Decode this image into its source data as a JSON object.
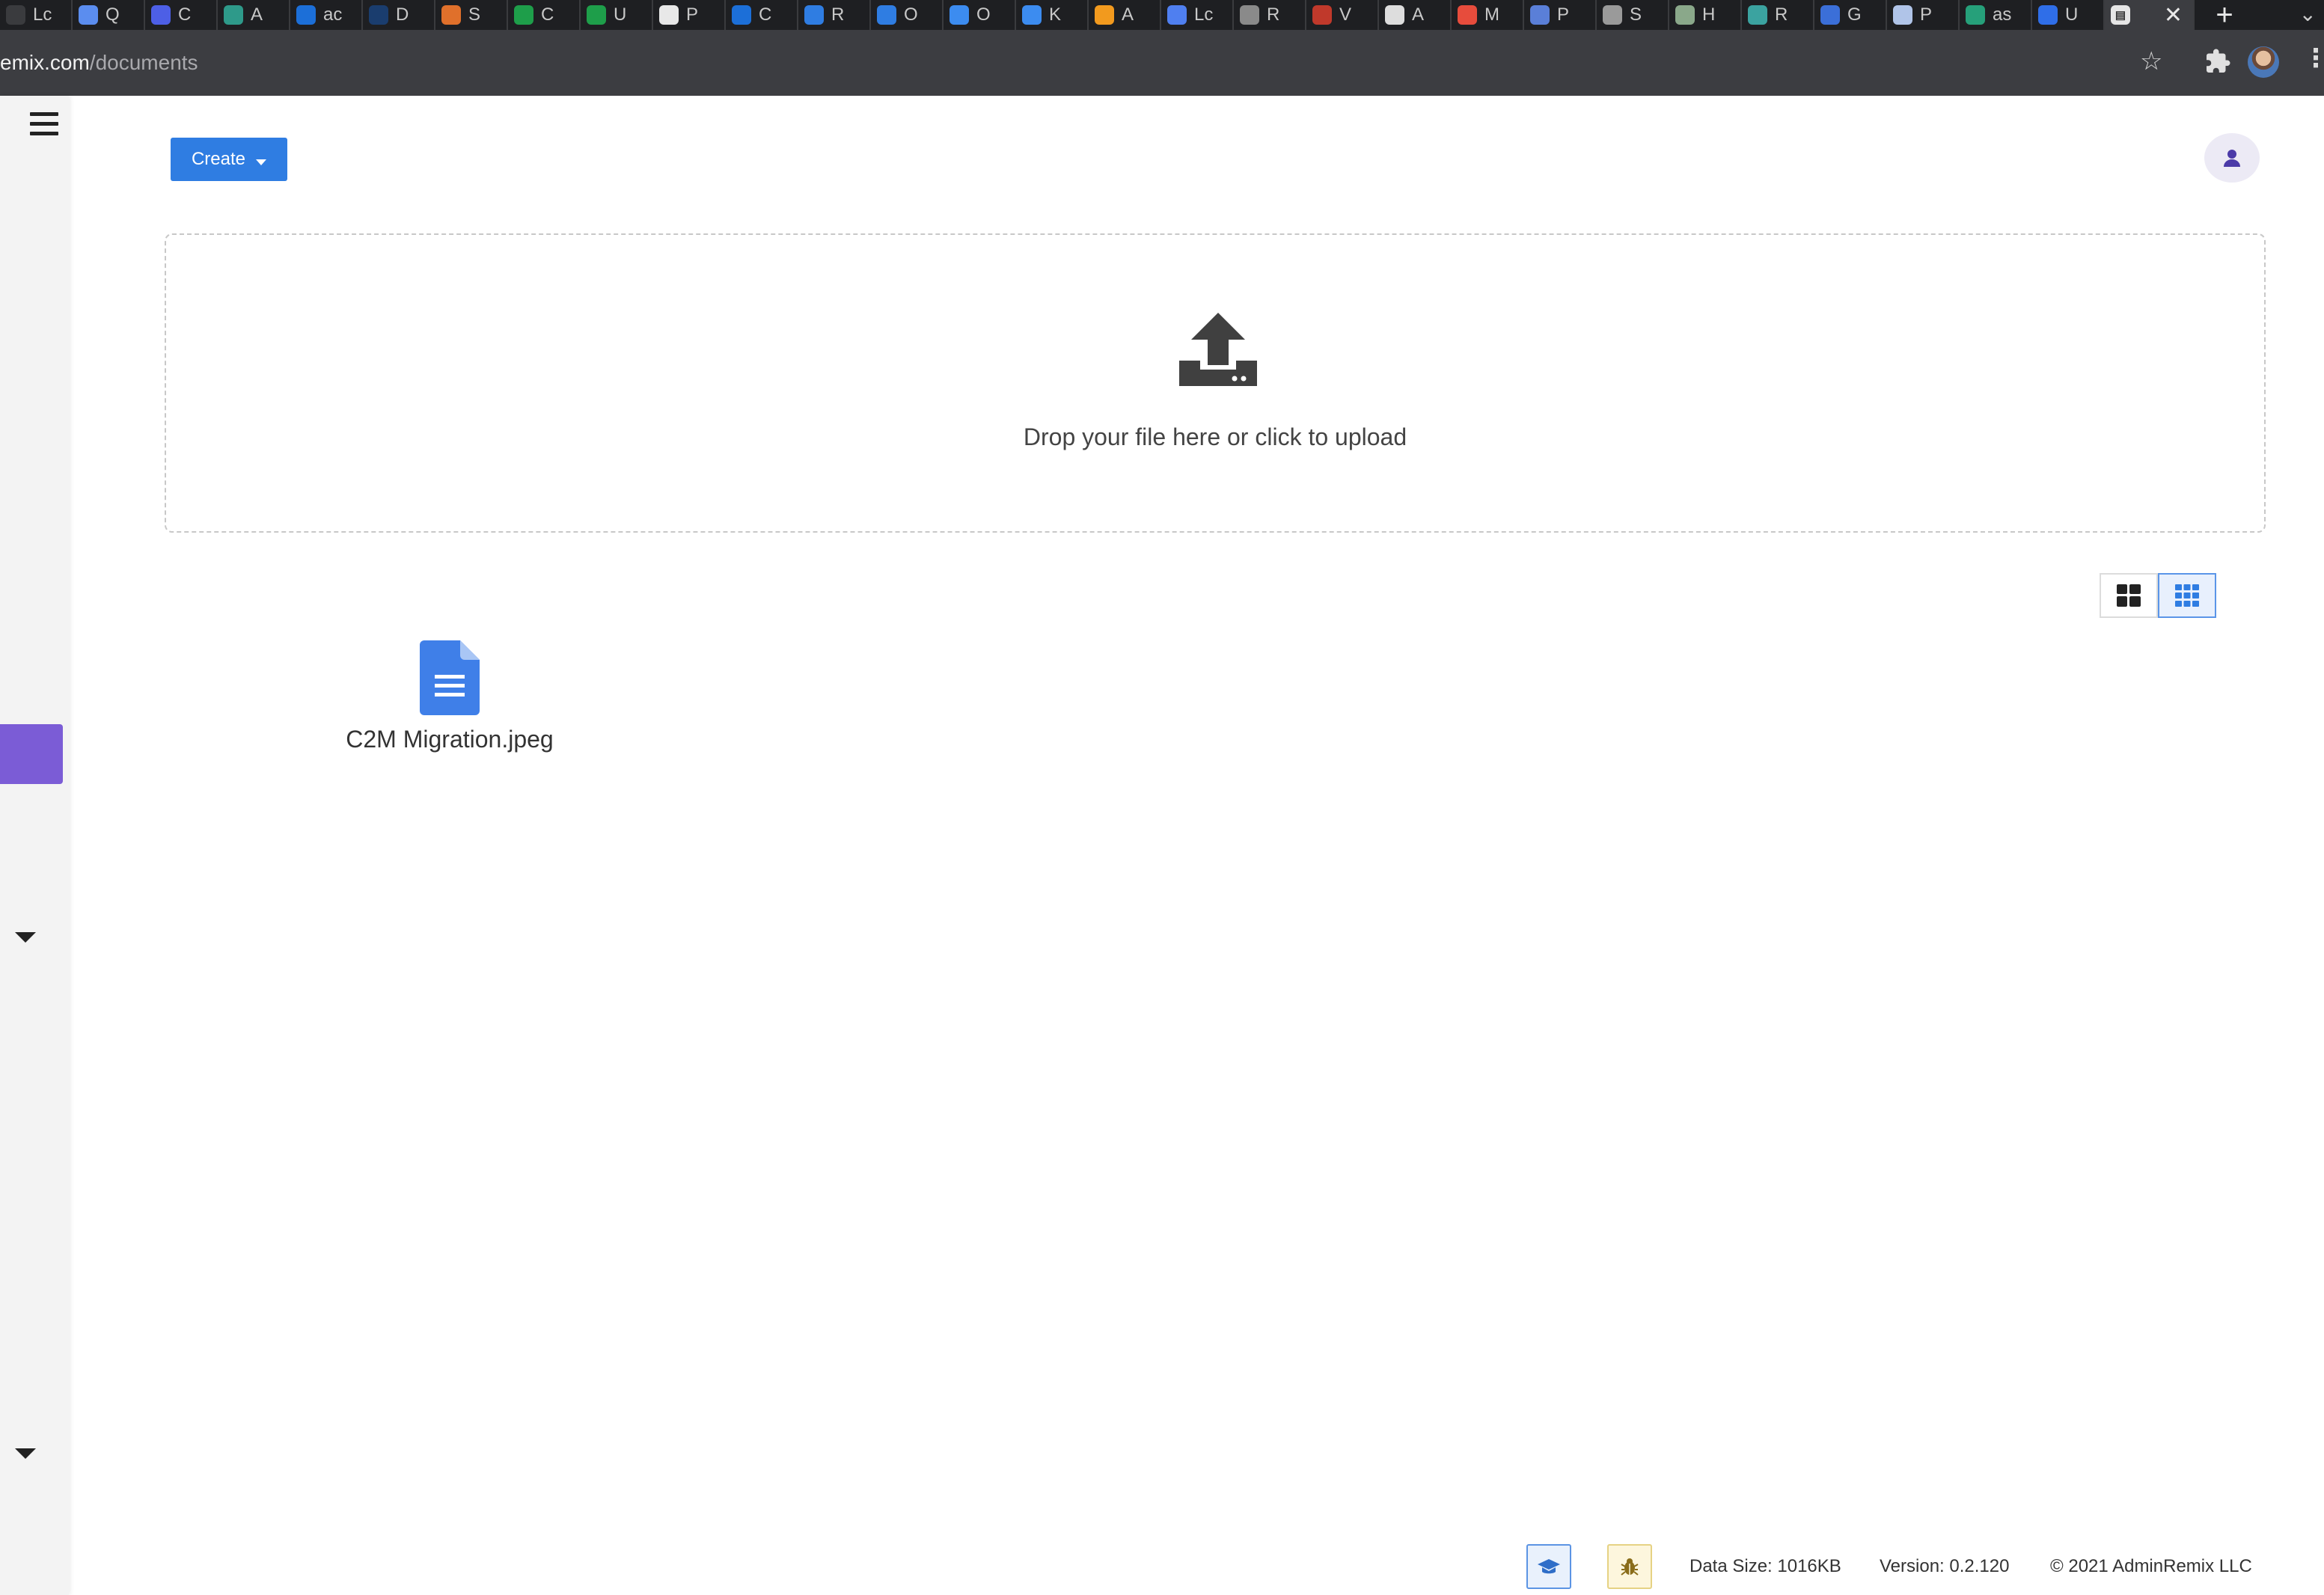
{
  "browser": {
    "tabs": [
      {
        "title": "Lc",
        "icon": "generic-tab-icon",
        "color": "#3a3b3e"
      },
      {
        "title": "Q",
        "icon": "q-tab-icon",
        "color": "#5b8def"
      },
      {
        "title": "C",
        "icon": "c-tab-icon",
        "color": "#4d5fe6"
      },
      {
        "title": "A",
        "icon": "gear-tab-icon",
        "color": "#2e9a8a"
      },
      {
        "title": "ac",
        "icon": "leaf-tab-icon",
        "color": "#1c6fd8"
      },
      {
        "title": "D",
        "icon": "w-tab-icon",
        "color": "#1a3d6e"
      },
      {
        "title": "S",
        "icon": "star-tab-icon",
        "color": "#e0702b"
      },
      {
        "title": "C",
        "icon": "sheets-tab-icon",
        "color": "#1e9e4a"
      },
      {
        "title": "U",
        "icon": "sheets-tab-icon",
        "color": "#1e9e4a"
      },
      {
        "title": "P",
        "icon": "github-tab-icon",
        "color": "#e8e8e8"
      },
      {
        "title": "C",
        "icon": "leaf-tab-icon",
        "color": "#1c6fd8"
      },
      {
        "title": "R",
        "icon": "target-tab-icon",
        "color": "#2f7de2"
      },
      {
        "title": "O",
        "icon": "target-tab-icon",
        "color": "#2f7de2"
      },
      {
        "title": "O",
        "icon": "ads-tab-icon",
        "color": "#3c8cf0"
      },
      {
        "title": "K",
        "icon": "ads-tab-icon",
        "color": "#3c8cf0"
      },
      {
        "title": "A",
        "icon": "analytics-tab-icon",
        "color": "#f29a1e"
      },
      {
        "title": "Lc",
        "icon": "doc-tab-icon",
        "color": "#4f7ff0"
      },
      {
        "title": "R",
        "icon": "globe-tab-icon",
        "color": "#8a8a8a"
      },
      {
        "title": "V",
        "icon": "flag-tab-icon",
        "color": "#c0392b"
      },
      {
        "title": "A",
        "icon": "spy-tab-icon",
        "color": "#dddddd"
      },
      {
        "title": "M",
        "icon": "m-tab-icon",
        "color": "#e74c3c"
      },
      {
        "title": "P",
        "icon": "octopus-tab-icon",
        "color": "#5a7fd8"
      },
      {
        "title": "S",
        "icon": "image-tab-icon",
        "color": "#9a9a9a"
      },
      {
        "title": "H",
        "icon": "circle-tab-icon",
        "color": "#8aa88a"
      },
      {
        "title": "R",
        "icon": "diamond-tab-icon",
        "color": "#3ba3a0"
      },
      {
        "title": "G",
        "icon": "mm-tab-icon",
        "color": "#3b6fd8"
      },
      {
        "title": "P",
        "icon": "shop-tab-icon",
        "color": "#b0c4e8"
      },
      {
        "title": "as",
        "icon": "diamond-tab-icon",
        "color": "#26a07a"
      },
      {
        "title": "U",
        "icon": "shield-tab-icon",
        "color": "#2f6ee8"
      }
    ],
    "url_host": "emix.com",
    "url_path": "/documents"
  },
  "toolbar": {
    "create_label": "Create"
  },
  "dropzone": {
    "text": "Drop your file here or click to upload"
  },
  "files": [
    {
      "name": "C2M Migration.jpeg",
      "icon": "document-file-icon"
    }
  ],
  "view_mode": "small-grid",
  "footer": {
    "data_size": "Data Size: 1016KB",
    "version": "Version: 0.2.120",
    "copyright": "© 2021 AdminRemix LLC"
  },
  "colors": {
    "primary": "#2f7de2",
    "sidebar_active": "#7b5cd6",
    "file_icon": "#3f7fe8"
  }
}
